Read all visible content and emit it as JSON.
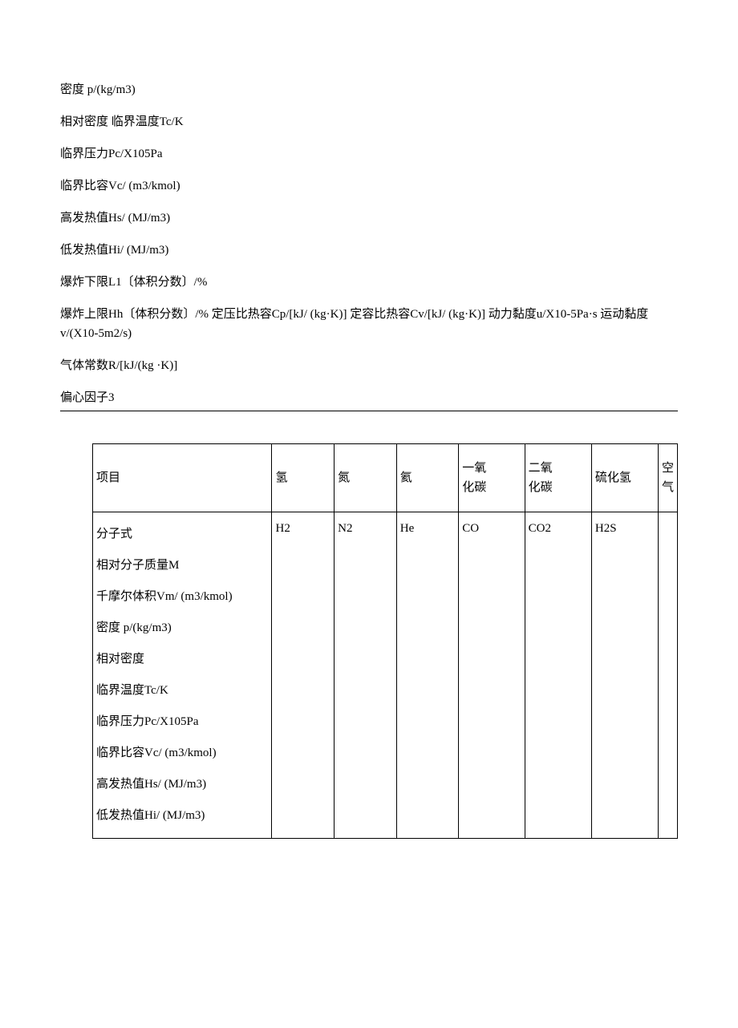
{
  "properties": [
    "密度  p/(kg/m3)",
    "相对密度  临界温度Tc/K",
    "临界压力Pc/X105Pa",
    "临界比容Vc/ (m3/kmol)",
    "高发热值Hs/ (MJ/m3)",
    "低发热值Hi/ (MJ/m3)",
    "爆炸下限L1〔体积分数〕/%",
    "爆炸上限Hh〔体积分数〕/%  定压比热容Cp/[kJ/ (kg·K)] 定容比热容Cv/[kJ/ (kg·K)] 动力黏度u/X10-5Pa·s 运动黏度   v/(X10-5m2/s)",
    "气体常数R/[kJ/(kg ·K)]",
    "偏心因子3"
  ],
  "table": {
    "headers": [
      "项目",
      "氢",
      "氮",
      "氦",
      "一氧\n化碳",
      "二氧\n化碳",
      "硫化氢",
      "空气"
    ],
    "row_labels": [
      "分子式",
      "相对分子质量M",
      "千摩尔体积Vm/ (m3/kmol)",
      "密度  p/(kg/m3)",
      "相对密度",
      "临界温度Tc/K",
      "临界压力Pc/X105Pa",
      "临界比容Vc/ (m3/kmol)",
      "高发热值Hs/ (MJ/m3)",
      "低发热值Hi/ (MJ/m3)"
    ],
    "formulas": [
      "H2",
      "N2",
      "He",
      "CO",
      "CO2",
      "H2S",
      ""
    ]
  }
}
